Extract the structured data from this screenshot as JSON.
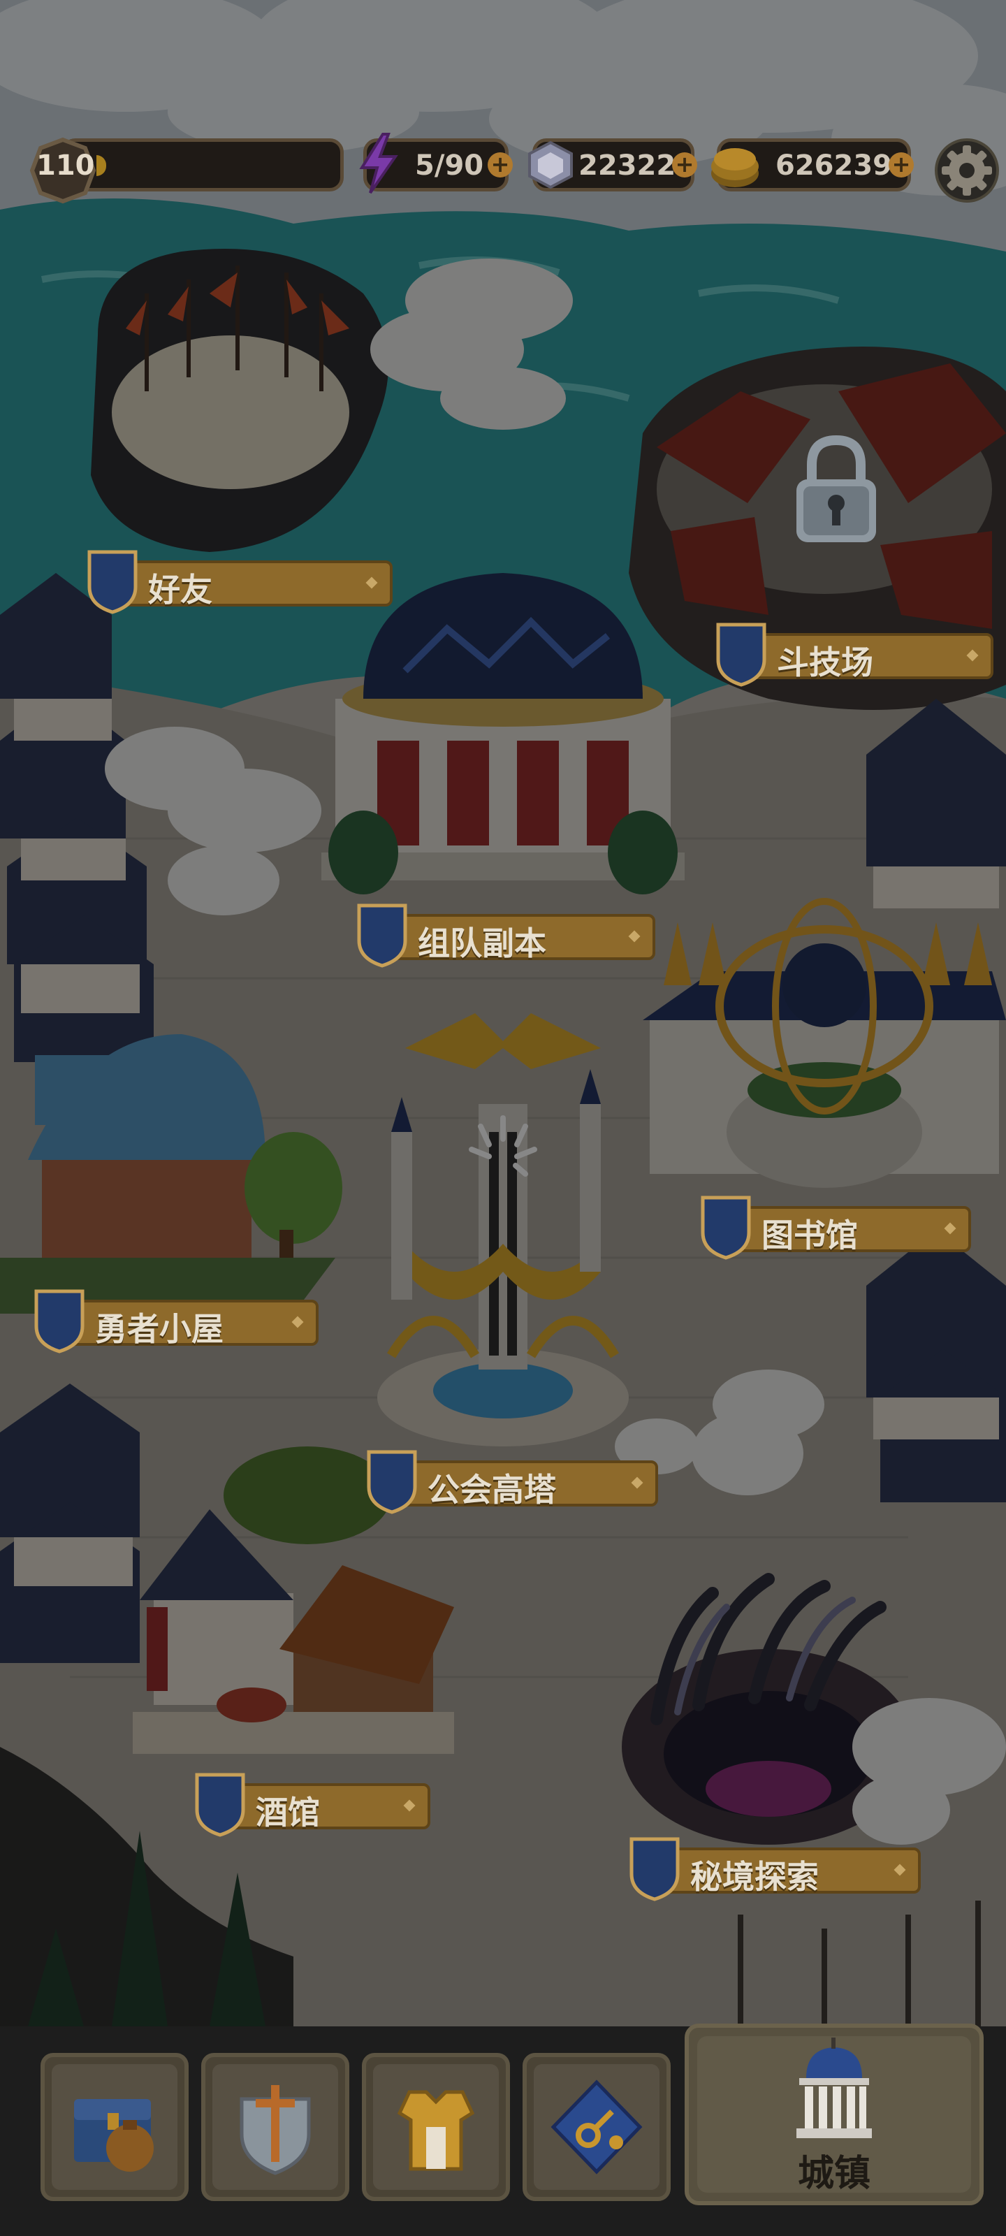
{
  "hud": {
    "level": "110",
    "energy": "5/90",
    "gems": "22322",
    "gold": "626239",
    "icons": [
      "level-badge-icon",
      "lightning-icon",
      "gem-icon",
      "gold-coin-icon",
      "gear-icon"
    ]
  },
  "buildings": {
    "friends": "好友",
    "arena": "斗技场",
    "team_dungeon": "组队副本",
    "library": "图书馆",
    "hero_house": "勇者小屋",
    "guild_tower": "公会高塔",
    "tavern": "酒馆",
    "secret_explore": "秘境探索"
  },
  "nav": {
    "items": [
      {
        "icon": "treasure-chest-icon"
      },
      {
        "icon": "sword-shield-icon"
      },
      {
        "icon": "armor-icon"
      },
      {
        "icon": "key-map-icon"
      }
    ],
    "active_label": "城镇",
    "active_icon": "town-hall-icon"
  },
  "colors": {
    "sea": "#2e8f93",
    "ground": "#9a958c",
    "ribbon": "#8e6a2b",
    "roof": "#2b3550"
  }
}
